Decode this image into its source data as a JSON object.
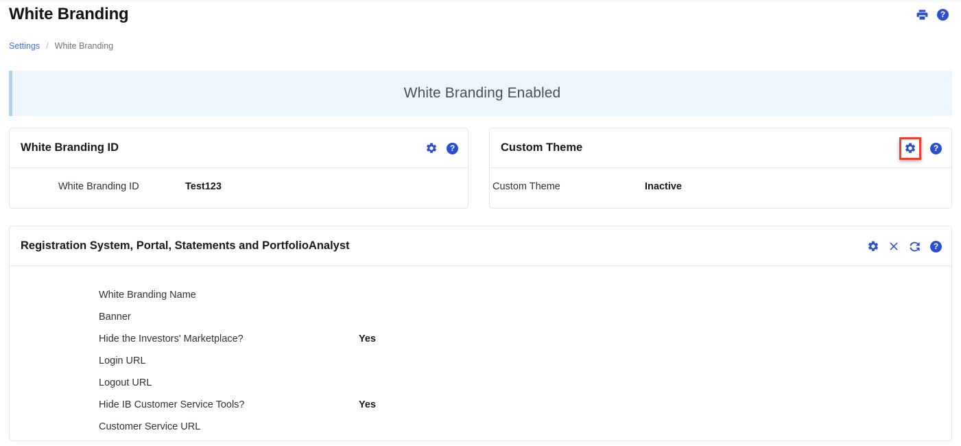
{
  "header": {
    "title": "White Branding",
    "icons": [
      {
        "name": "print-icon",
        "label": "Print"
      },
      {
        "name": "help-icon",
        "label": "?"
      }
    ]
  },
  "breadcrumb": {
    "parent": "Settings",
    "separator": "/",
    "current": "White Branding"
  },
  "banner": {
    "text": "White Branding Enabled",
    "background_color": "#eef6fd",
    "accent_color": "#a9d5f2",
    "text_color": "#495057"
  },
  "cards": {
    "white_branding_id": {
      "title": "White Branding ID",
      "icons": [
        {
          "name": "gear-icon",
          "label": "Settings"
        },
        {
          "name": "help-icon",
          "label": "?"
        }
      ],
      "rows": [
        {
          "label": "White Branding ID",
          "value": "Test123"
        }
      ]
    },
    "custom_theme": {
      "title": "Custom Theme",
      "icons": [
        {
          "name": "gear-icon",
          "label": "Settings",
          "highlighted": true
        },
        {
          "name": "help-icon",
          "label": "?"
        }
      ],
      "rows": [
        {
          "label": "Custom Theme",
          "value": "Inactive"
        }
      ]
    },
    "registration": {
      "title": "Registration System, Portal, Statements and PortfolioAnalyst",
      "icons": [
        {
          "name": "gear-icon",
          "label": "Settings"
        },
        {
          "name": "close-icon",
          "label": "Close"
        },
        {
          "name": "refresh-icon",
          "label": "Refresh"
        },
        {
          "name": "help-icon",
          "label": "?"
        }
      ],
      "rows": [
        {
          "label": "White Branding Name",
          "value": ""
        },
        {
          "label": "Banner",
          "value": ""
        },
        {
          "label": "Hide the Investors' Marketplace?",
          "value": "Yes"
        },
        {
          "label": "Login URL",
          "value": ""
        },
        {
          "label": "Logout URL",
          "value": ""
        },
        {
          "label": "Hide IB Customer Service Tools?",
          "value": "Yes"
        },
        {
          "label": "Customer Service URL",
          "value": ""
        }
      ]
    }
  },
  "theme": {
    "icon_color": "#2c4fd0",
    "link_color": "#4a6ee0",
    "highlight_color": "#f73b2e"
  }
}
